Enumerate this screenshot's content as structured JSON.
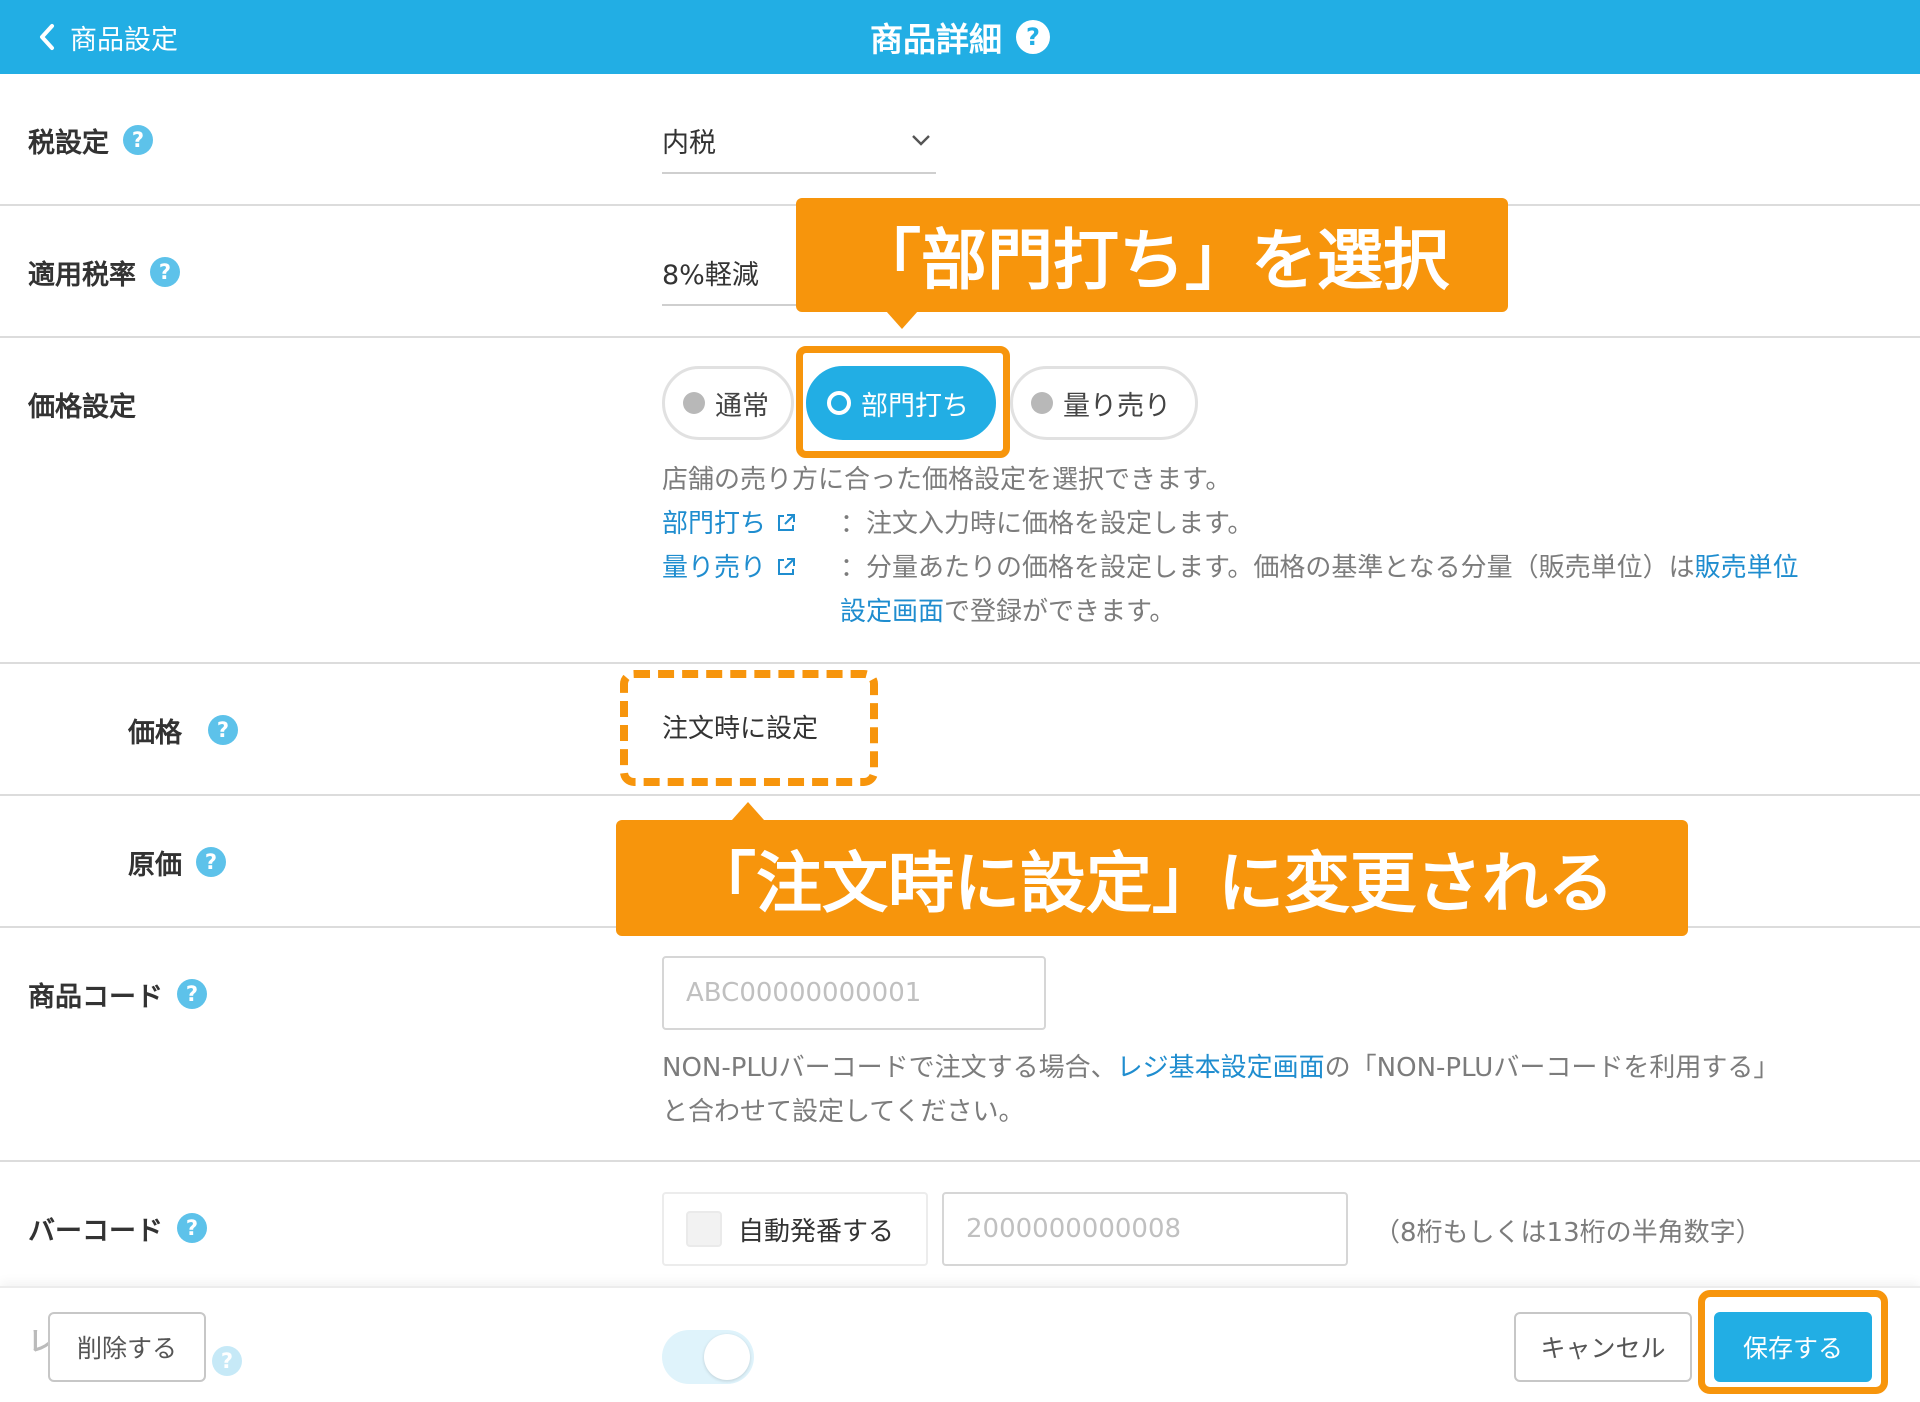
{
  "header": {
    "back_label": "商品設定",
    "title": "商品詳細"
  },
  "tax_setting": {
    "label": "税設定",
    "value": "内税"
  },
  "tax_rate": {
    "label": "適用税率",
    "value": "8%軽減"
  },
  "price_setting": {
    "label": "価格設定",
    "options": [
      "通常",
      "部門打ち",
      "量り売り"
    ],
    "selected": "部門打ち",
    "description": "店舗の売り方に合った価格設定を選択できます。",
    "items": [
      {
        "link": "部門打ち",
        "text": "：注文入力時に価格を設定します。"
      },
      {
        "link": "量り売り",
        "text": "：分量あたりの価格を設定します。価格の基準となる分量（販売単位）は",
        "link2": "販売単位",
        "link3": "設定画面",
        "text2": "で登録ができます。"
      }
    ]
  },
  "price": {
    "label": "価格",
    "value": "注文時に設定"
  },
  "cost": {
    "label": "原価"
  },
  "product_code": {
    "label": "商品コード",
    "placeholder": "ABC00000000001",
    "note_before": "NON-PLUバーコードで注文する場合、",
    "note_link": "レジ基本設定画面",
    "note_after": "の「NON-PLUバーコードを利用する」",
    "note_line2": "と合わせて設定してください。"
  },
  "barcode": {
    "label": "バーコード",
    "auto_label": "自動発番する",
    "placeholder": "2000000000008",
    "hint": "（8桁もしくは13桁の半角数字）"
  },
  "hidden_row_label": "レ",
  "footer": {
    "delete_label": "削除する",
    "cancel_label": "キャンセル",
    "save_label": "保存する"
  },
  "annotations": {
    "callout_select": "「部門打ち」を選択",
    "callout_change": "「注文時に設定」に変更される",
    "highlight_color": "#f7950c"
  },
  "colors": {
    "accent": "#22aee4",
    "link": "#1f8dcf",
    "callout": "#f7950c"
  }
}
